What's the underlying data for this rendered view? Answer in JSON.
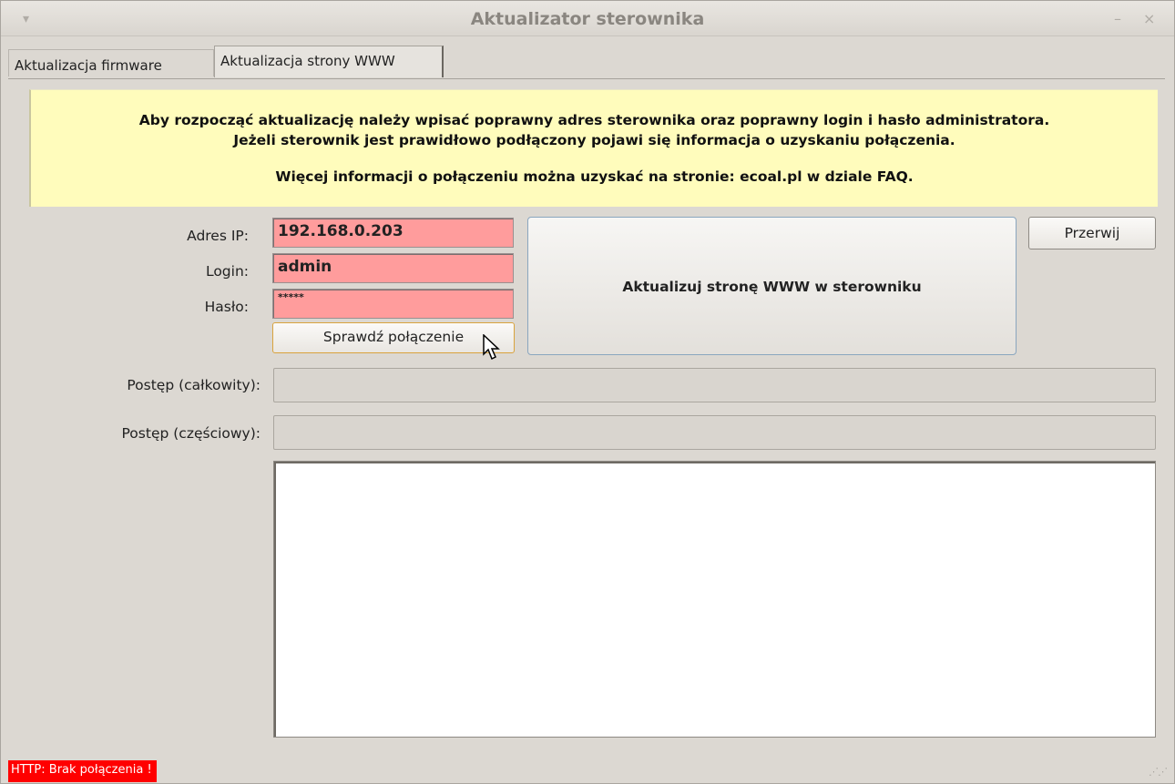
{
  "window": {
    "title": "Aktualizator sterownika",
    "minimize_glyph": "–",
    "close_glyph": "×",
    "menu_glyph": "▾"
  },
  "tabs": [
    {
      "label": "Aktualizacja firmware",
      "active": false
    },
    {
      "label": "Aktualizacja strony WWW",
      "active": true
    }
  ],
  "info": {
    "line1": "Aby rozpocząć aktualizację należy wpisać poprawny adres sterownika oraz poprawny login i hasło administratora.",
    "line2": "Jeżeli sterownik jest prawidłowo podłączony pojawi się informacja o uzyskaniu połączenia.",
    "line3": "Więcej informacji o połączeniu można uzyskać na stronie: ecoal.pl w dziale FAQ."
  },
  "form": {
    "ip_label": "Adres IP:",
    "ip_value": "192.168.0.203",
    "login_label": "Login:",
    "login_value": "admin",
    "password_label": "Hasło:",
    "password_value": "*****"
  },
  "buttons": {
    "check": "Sprawdź połączenie",
    "update": "Aktualizuj stronę WWW w sterowniku",
    "stop": "Przerwij"
  },
  "progress": {
    "total_label": "Postęp (całkowity):",
    "total_value": 0,
    "partial_label": "Postęp (częściowy):",
    "partial_value": 0
  },
  "status": {
    "text": "HTTP: Brak połączenia !",
    "color": "#ff0000"
  }
}
